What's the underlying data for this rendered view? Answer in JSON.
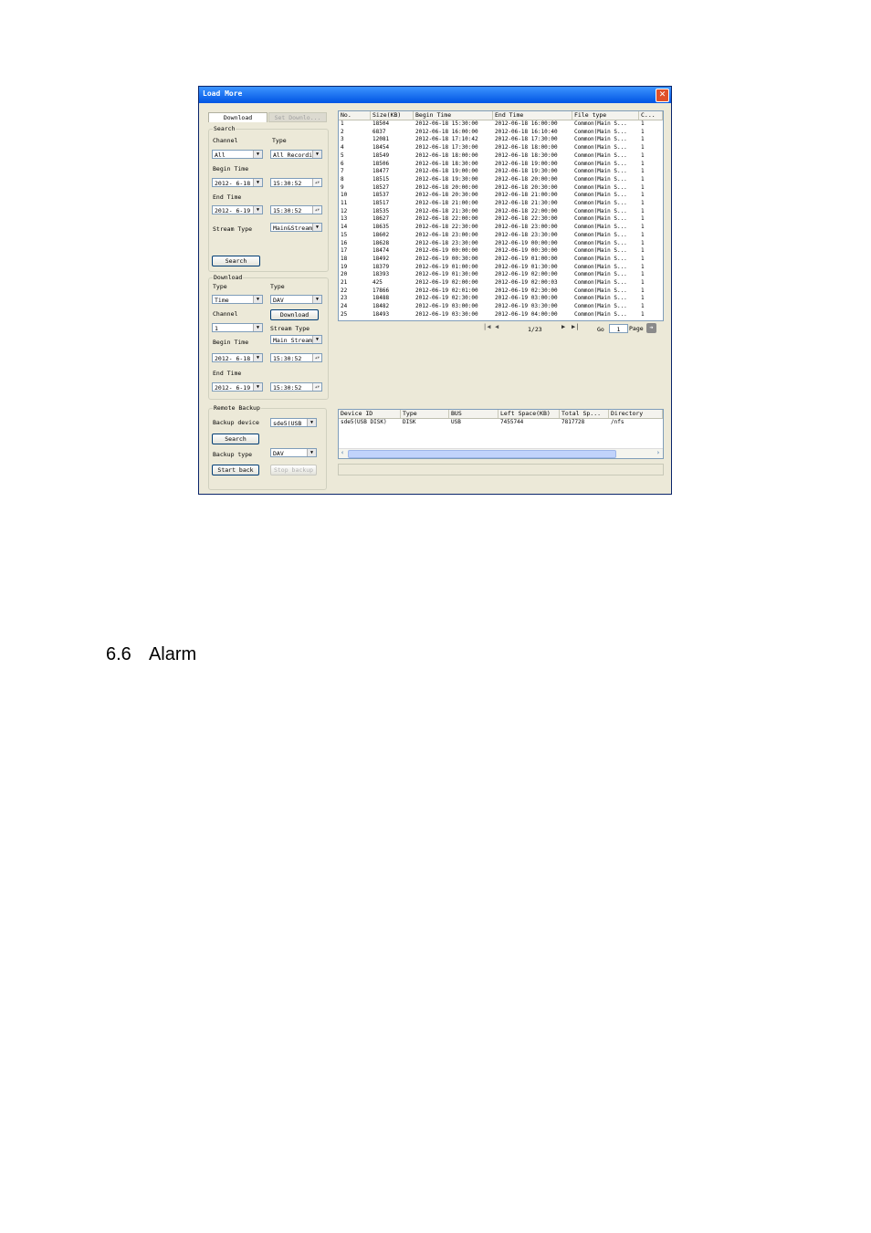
{
  "window": {
    "title": "Load More",
    "close_glyph": "✕"
  },
  "tabs": [
    {
      "label": "Download",
      "active": true
    },
    {
      "label": "Set Downlo...",
      "active": false
    }
  ],
  "search": {
    "legend": "Search",
    "channel_label": "Channel",
    "channel_value": "All",
    "type_label": "Type",
    "type_value": "All Recordi",
    "begin_time_label": "Begin Time",
    "begin_date": "2012- 6-18",
    "begin_clock": "15:30:52",
    "end_time_label": "End Time",
    "end_date": "2012- 6-19",
    "end_clock": "15:30:52",
    "stream_type_label": "Stream Type",
    "stream_type_value": "Main&Stream",
    "search_button": "Search"
  },
  "download": {
    "legend": "Download",
    "type_label": "Type",
    "type_value": "Time",
    "type2_label": "Type",
    "type2_value": "DAV",
    "channel_label": "Channel",
    "channel_value": "1",
    "download_button": "Download",
    "stream_type_label": "Stream Type",
    "stream_type_value": "Main Stream",
    "begin_time_label": "Begin Time",
    "begin_date": "2012- 6-18",
    "begin_clock": "15:30:52",
    "end_time_label": "End Time",
    "end_date": "2012- 6-19",
    "end_clock": "15:30:52"
  },
  "remote_backup": {
    "legend": "Remote Backup",
    "device_label": "Backup device",
    "device_value": "sde5(USB",
    "search_button": "Search",
    "backup_type_label": "Backup type",
    "backup_type_value": "DAV",
    "start_button": "Start back",
    "stop_button": "Stop backup"
  },
  "file_table": {
    "headers": [
      "No.",
      "Size(KB)",
      "Begin Time",
      "End Time",
      "File type",
      "C..."
    ],
    "rows": [
      [
        "1",
        "18504",
        "2012-06-18 15:30:00",
        "2012-06-18 16:00:00",
        "Common(Main S...",
        "1"
      ],
      [
        "2",
        "6837",
        "2012-06-18 16:00:00",
        "2012-06-18 16:10:40",
        "Common(Main S...",
        "1"
      ],
      [
        "3",
        "12081",
        "2012-06-18 17:10:42",
        "2012-06-18 17:30:00",
        "Common(Main S...",
        "1"
      ],
      [
        "4",
        "18454",
        "2012-06-18 17:30:00",
        "2012-06-18 18:00:00",
        "Common(Main S...",
        "1"
      ],
      [
        "5",
        "18549",
        "2012-06-18 18:00:00",
        "2012-06-18 18:30:00",
        "Common(Main S...",
        "1"
      ],
      [
        "6",
        "18506",
        "2012-06-18 18:30:00",
        "2012-06-18 19:00:00",
        "Common(Main S...",
        "1"
      ],
      [
        "7",
        "18477",
        "2012-06-18 19:00:00",
        "2012-06-18 19:30:00",
        "Common(Main S...",
        "1"
      ],
      [
        "8",
        "18515",
        "2012-06-18 19:30:00",
        "2012-06-18 20:00:00",
        "Common(Main S...",
        "1"
      ],
      [
        "9",
        "18527",
        "2012-06-18 20:00:00",
        "2012-06-18 20:30:00",
        "Common(Main S...",
        "1"
      ],
      [
        "10",
        "18537",
        "2012-06-18 20:30:00",
        "2012-06-18 21:00:00",
        "Common(Main S...",
        "1"
      ],
      [
        "11",
        "18517",
        "2012-06-18 21:00:00",
        "2012-06-18 21:30:00",
        "Common(Main S...",
        "1"
      ],
      [
        "12",
        "18535",
        "2012-06-18 21:30:00",
        "2012-06-18 22:00:00",
        "Common(Main S...",
        "1"
      ],
      [
        "13",
        "18627",
        "2012-06-18 22:00:00",
        "2012-06-18 22:30:00",
        "Common(Main S...",
        "1"
      ],
      [
        "14",
        "18635",
        "2012-06-18 22:30:00",
        "2012-06-18 23:00:00",
        "Common(Main S...",
        "1"
      ],
      [
        "15",
        "18602",
        "2012-06-18 23:00:00",
        "2012-06-18 23:30:00",
        "Common(Main S...",
        "1"
      ],
      [
        "16",
        "18628",
        "2012-06-18 23:30:00",
        "2012-06-19 00:00:00",
        "Common(Main S...",
        "1"
      ],
      [
        "17",
        "18474",
        "2012-06-19 00:00:00",
        "2012-06-19 00:30:00",
        "Common(Main S...",
        "1"
      ],
      [
        "18",
        "18492",
        "2012-06-19 00:30:00",
        "2012-06-19 01:00:00",
        "Common(Main S...",
        "1"
      ],
      [
        "19",
        "18379",
        "2012-06-19 01:00:00",
        "2012-06-19 01:30:00",
        "Common(Main S...",
        "1"
      ],
      [
        "20",
        "18393",
        "2012-06-19 01:30:00",
        "2012-06-19 02:00:00",
        "Common(Main S...",
        "1"
      ],
      [
        "21",
        "425",
        "2012-06-19 02:00:00",
        "2012-06-19 02:00:03",
        "Common(Main S...",
        "1"
      ],
      [
        "22",
        "17866",
        "2012-06-19 02:01:00",
        "2012-06-19 02:30:00",
        "Common(Main S...",
        "1"
      ],
      [
        "23",
        "18488",
        "2012-06-19 02:30:00",
        "2012-06-19 03:00:00",
        "Common(Main S...",
        "1"
      ],
      [
        "24",
        "18482",
        "2012-06-19 03:00:00",
        "2012-06-19 03:30:00",
        "Common(Main S...",
        "1"
      ],
      [
        "25",
        "18493",
        "2012-06-19 03:30:00",
        "2012-06-19 04:00:00",
        "Common(Main S...",
        "1"
      ]
    ]
  },
  "pager": {
    "page_text": "1/23",
    "go_label": "Go",
    "go_value": "1",
    "page_label": "Page"
  },
  "device_table": {
    "headers": [
      "Device ID",
      "Type",
      "BUS",
      "Left Space(KB)",
      "Total Sp...",
      "Directory"
    ],
    "rows": [
      [
        "sde5(USB DISK)",
        "DISK",
        "USB",
        "7455744",
        "7817728",
        "/nfs"
      ]
    ]
  },
  "doc": {
    "section_number": "6.6",
    "section_title": "Alarm"
  }
}
